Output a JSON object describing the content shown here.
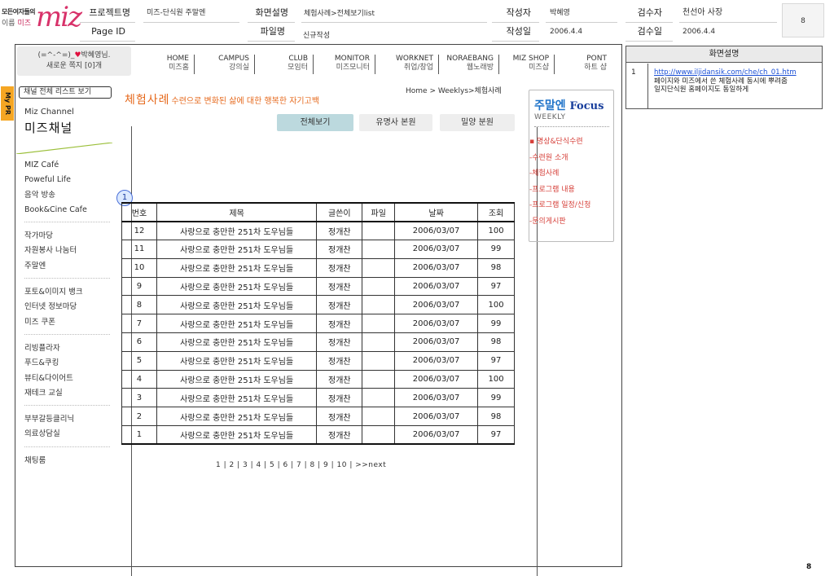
{
  "spec": {
    "logo": {
      "line1": "모든여자들의",
      "line2_prefix": "이름",
      "line2_brand": "미즈",
      "mark": "miz"
    },
    "project_label": "프로젝트명",
    "project_value": "미즈-단식원 주말엔",
    "screen_desc_label": "화면설명",
    "screen_desc_value": "체험사례>전체보기list",
    "author_label": "작성자",
    "author_value": "박혜영",
    "reviewer_label": "검수자",
    "reviewer_value": "천선아 사장",
    "page_id_label": "Page ID",
    "file_label": "파일명",
    "file_value": "신규작성",
    "date_label": "작성일",
    "date_value": "2006.4.4",
    "review_date_label": "검수일",
    "review_date_value": "2006.4.4",
    "page_no": "8"
  },
  "user": {
    "line1_prefix": "(=^-^=)_",
    "heart": "♥",
    "line1_suffix": "박혜영님.",
    "line2": "새로운 쪽지 [0]개"
  },
  "nav": [
    {
      "en": "HOME",
      "ko": "미즈홈"
    },
    {
      "en": "CAMPUS",
      "ko": "강의실"
    },
    {
      "en": "CLUB",
      "ko": "모임터"
    },
    {
      "en": "MONITOR",
      "ko": "미즈모니터"
    },
    {
      "en": "WORKNET",
      "ko": "취업/창업"
    },
    {
      "en": "NORAEBANG",
      "ko": "웹노래방"
    },
    {
      "en": "MIZ SHOP",
      "ko": "미즈샵"
    },
    {
      "en": "PONT",
      "ko": "하트 샵"
    }
  ],
  "side": {
    "mypr": "My PR",
    "channel_list": "채널 전체 리스트 보기",
    "channel_sub": "Miz Channel",
    "channel_title": "미즈채널",
    "groups": [
      [
        "MIZ Café",
        "Poweful Life",
        "음악 방송",
        "Book&Cine Cafe"
      ],
      [
        "작가마당",
        "자원봉사 나눔터",
        "주말엔"
      ],
      [
        "포토&이미지 뱅크",
        "인터넷 정보마당",
        "미즈 쿠폰"
      ],
      [
        "리빙플라자",
        "푸드&쿠킹",
        "뷰티&다이어트",
        "재테크 교실"
      ],
      [
        "부부갈등클리닉",
        "의료상담실"
      ],
      [
        "채팅룸"
      ]
    ]
  },
  "content": {
    "breadcrumb": "Home > Weeklys>체험사례",
    "title": "체험사례",
    "subtitle": "수련으로 변화된 삶에 대한 행복한 자기고백",
    "tabs": [
      "전체보기",
      "유명사 본원",
      "밀양 분원"
    ],
    "annotation_badge": "1",
    "table": {
      "headers": [
        "번호",
        "제목",
        "글쓴이",
        "파일",
        "날짜",
        "조회"
      ],
      "rows": [
        [
          "12",
          "사랑으로 충만한 251차 도우님들",
          "정개찬",
          "",
          "2006/03/07",
          "100"
        ],
        [
          "11",
          "사랑으로 충만한 251차 도우님들",
          "정개찬",
          "",
          "2006/03/07",
          "99"
        ],
        [
          "10",
          "사랑으로 충만한 251차 도우님들",
          "정개찬",
          "",
          "2006/03/07",
          "98"
        ],
        [
          "9",
          "사랑으로 충만한 251차 도우님들",
          "정개찬",
          "",
          "2006/03/07",
          "97"
        ],
        [
          "8",
          "사랑으로 충만한 251차 도우님들",
          "정개찬",
          "",
          "2006/03/07",
          "100"
        ],
        [
          "7",
          "사랑으로 충만한 251차 도우님들",
          "정개찬",
          "",
          "2006/03/07",
          "99"
        ],
        [
          "6",
          "사랑으로 충만한 251차 도우님들",
          "정개찬",
          "",
          "2006/03/07",
          "98"
        ],
        [
          "5",
          "사랑으로 충만한 251차 도우님들",
          "정개찬",
          "",
          "2006/03/07",
          "97"
        ],
        [
          "4",
          "사랑으로 충만한 251차 도우님들",
          "정개찬",
          "",
          "2006/03/07",
          "100"
        ],
        [
          "3",
          "사랑으로 충만한 251차 도우님들",
          "정개찬",
          "",
          "2006/03/07",
          "99"
        ],
        [
          "2",
          "사랑으로 충만한 251차 도우님들",
          "정개찬",
          "",
          "2006/03/07",
          "98"
        ],
        [
          "1",
          "사랑으로 충만한 251차 도우님들",
          "정개찬",
          "",
          "2006/03/07",
          "97"
        ]
      ]
    },
    "pagination": {
      "pages": [
        "1",
        "2",
        "3",
        "4",
        "5",
        "6",
        "7",
        "8",
        "9",
        "10"
      ],
      "separator": " | ",
      "next": ">>next"
    }
  },
  "focus": {
    "title_ko": "주말엔",
    "title_en": "Focus",
    "weekly": "WEEKLY",
    "items": [
      "▪ 명상&단식수련",
      "-수련원 소개",
      "-체험사례",
      "-프로그램 내용",
      "-프로그램 일정/신청",
      "-문의게시판"
    ]
  },
  "description": {
    "header": "화면설명",
    "num": "1",
    "link": "http://www.iljidansik.com/che/ch_01.htm",
    "line2": "페이지와 미즈에서 쓴 체험사례 동시에 뿌려줌",
    "line3": "일지단식원 홈페이지도 동일하게"
  },
  "page_footer": "8",
  "colors": {
    "brand_pink": "#d8326a",
    "title_orange": "#e66a1e",
    "focus_blue": "#1f73c9",
    "menu_red": "#d6403a",
    "active_tab": "#bcd9de",
    "mypr_tab": "#f5a623"
  }
}
